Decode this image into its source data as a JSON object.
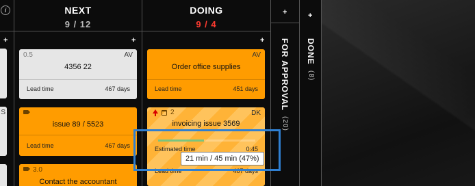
{
  "columns": {
    "next": {
      "title": "NEXT",
      "count": "9 / 12",
      "add_label": "+"
    },
    "doing": {
      "title": "DOING",
      "count": "9 / 4",
      "add_label": "+"
    },
    "for_approval": {
      "title": "FOR APPROVAL",
      "count": "(20)"
    },
    "done": {
      "title": "DONE",
      "count": "(8)"
    },
    "add_symbol": "+",
    "info_symbol": "i"
  },
  "cards": {
    "left_partial": {
      "owner_fragment": "S"
    },
    "next_1": {
      "size": "0.5",
      "owner": "AV",
      "title": "4356 22",
      "metric_label": "Lead time",
      "metric_value": "467 days"
    },
    "next_2": {
      "title": "issue 89 / 5523",
      "metric_label": "Lead time",
      "metric_value": "467 days"
    },
    "next_3": {
      "size": "3.0",
      "title": "Contact the accountant"
    },
    "doing_1": {
      "owner": "AV",
      "title": "Order office supplies",
      "metric_label": "Lead time",
      "metric_value": "451 days"
    },
    "doing_2": {
      "size": "2",
      "owner": "DK",
      "title": "invoicing issue 3569",
      "metric_label": "Estimated time",
      "metric_value": "0:45",
      "progress": 0.47,
      "hidden_label": "Lead time",
      "hidden_value": "467 days"
    }
  },
  "tooltip": {
    "text": "21 min / 45 min (47%)"
  },
  "colors": {
    "card_orange": "#ff9c00",
    "card_gray": "#e6e6e6",
    "over_limit": "#ff3b30",
    "highlight": "#2f7fd1",
    "progress": "#7bc47f"
  },
  "icons": [
    "info-icon",
    "tag-icon",
    "priority-up-icon",
    "calendar-icon",
    "add-icon"
  ]
}
